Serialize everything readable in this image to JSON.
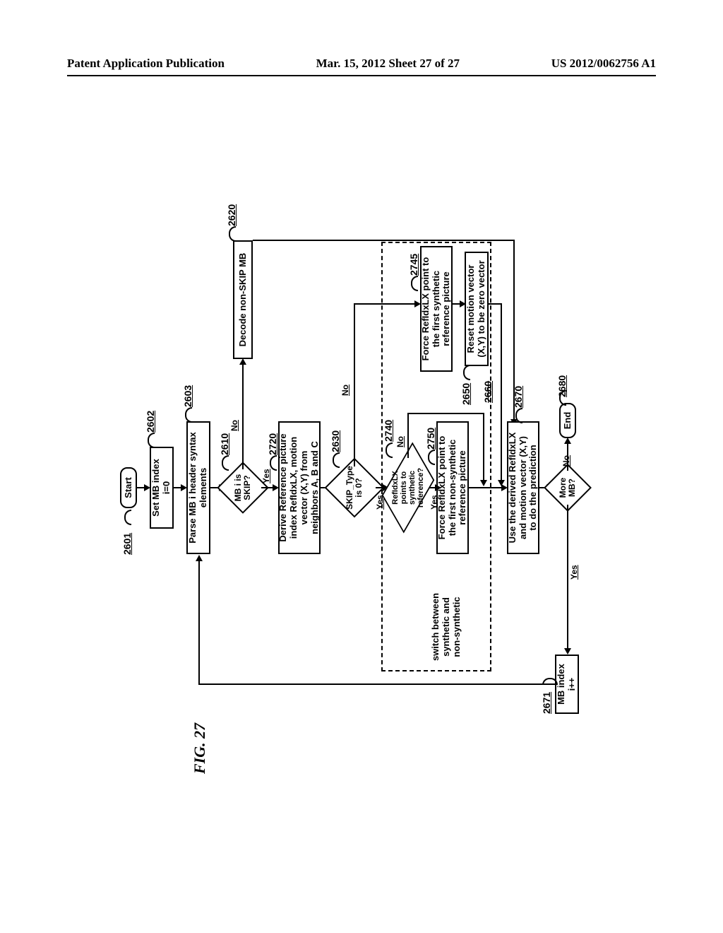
{
  "header": {
    "left": "Patent Application Publication",
    "mid": "Mar. 15, 2012  Sheet 27 of 27",
    "right": "US 2012/0062756 A1"
  },
  "figure_label": "FIG. 27",
  "nodes": {
    "start": "Start",
    "set_index": "Set MB index\ni=0",
    "parse": "Parse MB i header syntax\nelements",
    "skip_q": "MB i is\nSKIP?",
    "decode_nonskip": "Decode non-SKIP MB",
    "derive": "Derive Reference picture\nindex RefIdxLX, motion\nvector (X,Y) from\nneighbors A, B and C",
    "skip_type_q": "SKIP_Type\nis 0?",
    "points_q": "RefIdxLX points to\nsynthetic reference?",
    "force_nonsyn": "Force RefIdxLX point to\nthe first non-synthetic\nreference picture",
    "force_syn": "Force RefIdxLX point to\nthe first synthetic\nreference picture",
    "reset_mv": "Reset motion vector\n(X,Y) to be zero vector",
    "use_pred": "Use the derived RefIdxLX\nand motion vector (X,Y)\nto do the prediction",
    "more_q": "More\nMB?",
    "end": "End",
    "mb_index": "MB index\ni++"
  },
  "edge_labels": {
    "yes": "Yes",
    "no": "No"
  },
  "annotations": {
    "switch_note": "switch between\nsynthetic and\nnon-synthetic"
  },
  "refs": {
    "r2601": "2601",
    "r2602": "2602",
    "r2603": "2603",
    "r2610": "2610",
    "r2620": "2620",
    "r2720": "2720",
    "r2630": "2630",
    "r2740": "2740",
    "r2745": "2745",
    "r2750": "2750",
    "r2650": "2650",
    "r2660": "2660",
    "r2670": "2670",
    "r2671": "2671",
    "r2680": "2680"
  }
}
